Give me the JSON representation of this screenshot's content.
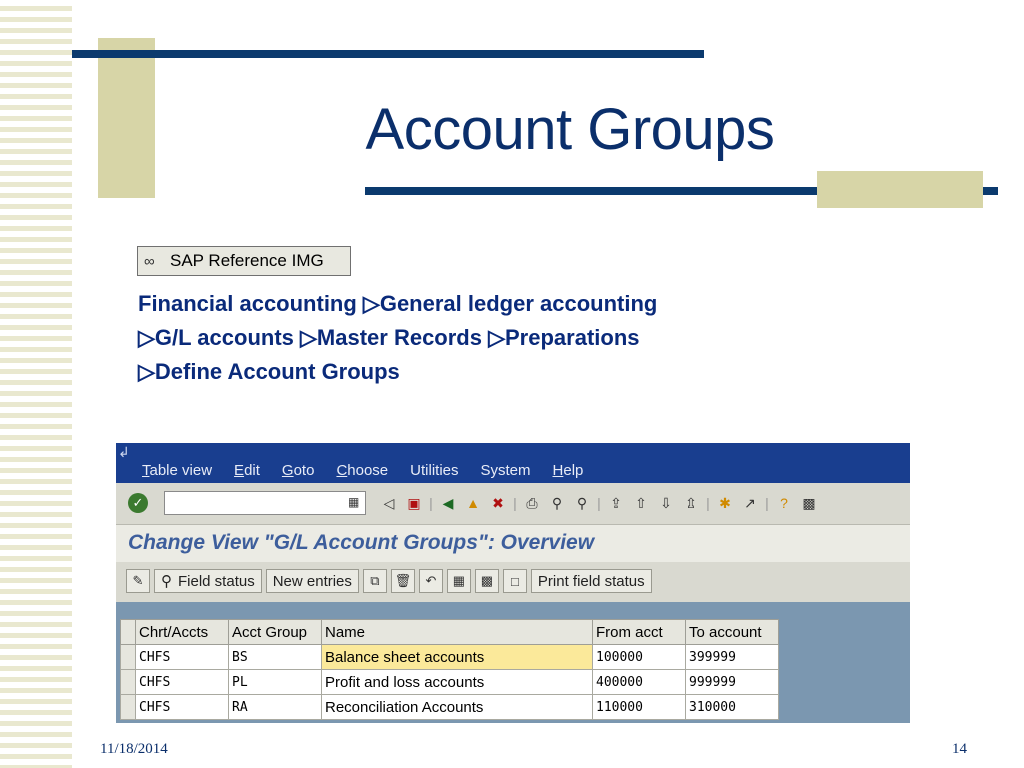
{
  "slide": {
    "title": "Account Groups",
    "date": "11/18/2014",
    "page_number": "14"
  },
  "img_button": {
    "icon": "glasses-icon",
    "label": "SAP Reference IMG"
  },
  "path": {
    "line1": "Financial accounting ▷General ledger accounting",
    "line2": "▷G/L accounts ▷Master Records ▷Preparations",
    "line3": "▷Define Account Groups"
  },
  "sap": {
    "menu": [
      "Table view",
      "Edit",
      "Goto",
      "Choose",
      "Utilities",
      "System",
      "Help"
    ],
    "command_field_value": "",
    "screen_title": "Change View \"G/L Account Groups\": Overview",
    "app_toolbar": {
      "field_status": "Field status",
      "new_entries": "New entries",
      "print_field_status": "Print field status"
    },
    "table": {
      "columns": [
        "Chrt/Accts",
        "Acct Group",
        "Name",
        "From acct",
        "To account"
      ],
      "rows": [
        [
          "CHFS",
          "BS",
          "Balance sheet accounts",
          "100000",
          "399999"
        ],
        [
          "CHFS",
          "PL",
          "Profit and loss accounts",
          "400000",
          "999999"
        ],
        [
          "CHFS",
          "RA",
          "Reconciliation Accounts",
          "110000",
          "310000"
        ]
      ]
    }
  },
  "colors": {
    "title": "#0b2f6b",
    "navy_line": "#0b3a6e",
    "olive": "#d7d5a7",
    "sap_menubar": "#193e8f",
    "selected_cell": "#fbe99a"
  }
}
